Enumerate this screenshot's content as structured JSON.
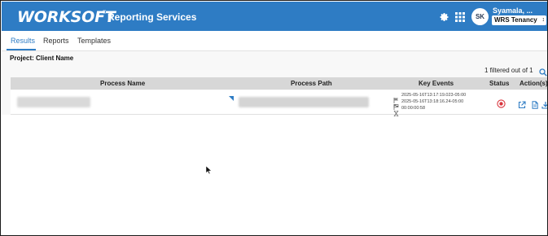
{
  "header": {
    "logo_text": "WORKSOFT",
    "logo_mark": "®",
    "app_title": "Reporting Services",
    "icons": [
      "gear-icon",
      "apps-grid-icon"
    ],
    "avatar_initials": "SK",
    "user_name": "Syamala, ...",
    "tenancy_value": "WRS Tenancy"
  },
  "tabs": [
    {
      "label": "Results",
      "active": true
    },
    {
      "label": "Reports",
      "active": false
    },
    {
      "label": "Templates",
      "active": false
    }
  ],
  "project_label": "Project: Client Name",
  "filter_summary": "1 filtered out of 1",
  "table": {
    "columns": [
      "Process Name",
      "Process Path",
      "Key Events",
      "Status",
      "Action(s)"
    ],
    "rows": [
      {
        "key_events": {
          "start": "2025-05-16T13:17:19.023-05:00",
          "end": "2025-05-16T13:18:16.24-05:00",
          "duration": "00:00:00:58"
        },
        "status_icon": "failed-icon",
        "actions": [
          "open-external-icon",
          "document-icon",
          "download-icon"
        ]
      }
    ]
  },
  "colors": {
    "brand_blue": "#2e7cc4",
    "header_gray": "#d7d7d7",
    "status_red": "#d9363e"
  }
}
